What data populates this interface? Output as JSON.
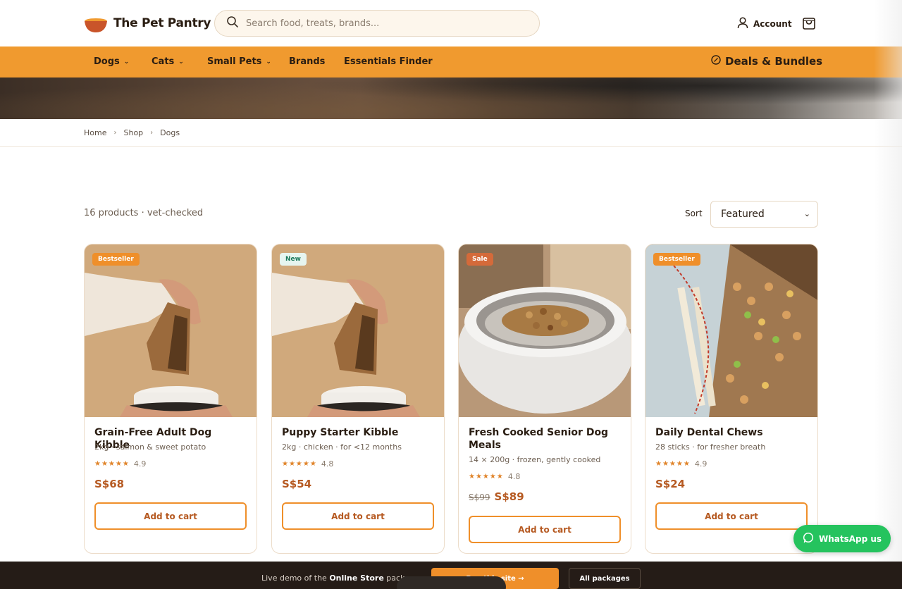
{
  "header": {
    "brand": "The Pet Pantry",
    "search_placeholder": "Search food, treats, brands...",
    "account_label": "Account"
  },
  "nav": {
    "items": [
      {
        "label": "Dogs",
        "has_menu": true
      },
      {
        "label": "Cats",
        "has_menu": true
      },
      {
        "label": "Small Pets",
        "has_menu": true
      },
      {
        "label": "Brands",
        "has_menu": false
      },
      {
        "label": "Essentials Finder",
        "has_menu": false
      }
    ],
    "deals_label": "Deals & Bundles"
  },
  "breadcrumb": [
    "Home",
    "Shop",
    "Dogs"
  ],
  "toolbar": {
    "count_text": "16 products · vet-checked",
    "sort_label": "Sort",
    "sort_value": "Featured"
  },
  "products": [
    {
      "badge": "Bestseller",
      "title": "Grain-Free Adult Dog Kibble",
      "subtitle": "2kg · salmon & sweet potato",
      "stars": "★★★★★",
      "rating": "4.9",
      "price": "S$68",
      "old_price": "",
      "button": "Add to cart"
    },
    {
      "badge": "New",
      "title": "Puppy Starter Kibble",
      "subtitle": "2kg · chicken · for <12 months",
      "stars": "★★★★★",
      "rating": "4.8",
      "price": "S$54",
      "old_price": "",
      "button": "Add to cart"
    },
    {
      "badge": "Sale",
      "title": "Fresh Cooked Senior Dog Meals",
      "subtitle": "14 × 200g · frozen, gently cooked",
      "stars": "★★★★★",
      "rating": "4.8",
      "price": "S$89",
      "old_price": "S$99",
      "button": "Add to cart"
    },
    {
      "badge": "Bestseller",
      "title": "Daily Dental Chews",
      "subtitle": "28 sticks · for fresher breath",
      "stars": "★★★★★",
      "rating": "4.9",
      "price": "S$24",
      "old_price": "",
      "button": "Add to cart"
    }
  ],
  "whatsapp_label": "WhatsApp us",
  "demo_bar": {
    "text_prefix": "Live demo of the",
    "text_bold": "Online Store",
    "text_suffix": "pack",
    "cta": "Buy this site →",
    "packages": "All packages"
  },
  "colors": {
    "accent": "#f09a2f",
    "price": "#b65a22",
    "whatsapp": "#25c35e",
    "demo_bar": "#251c17"
  }
}
